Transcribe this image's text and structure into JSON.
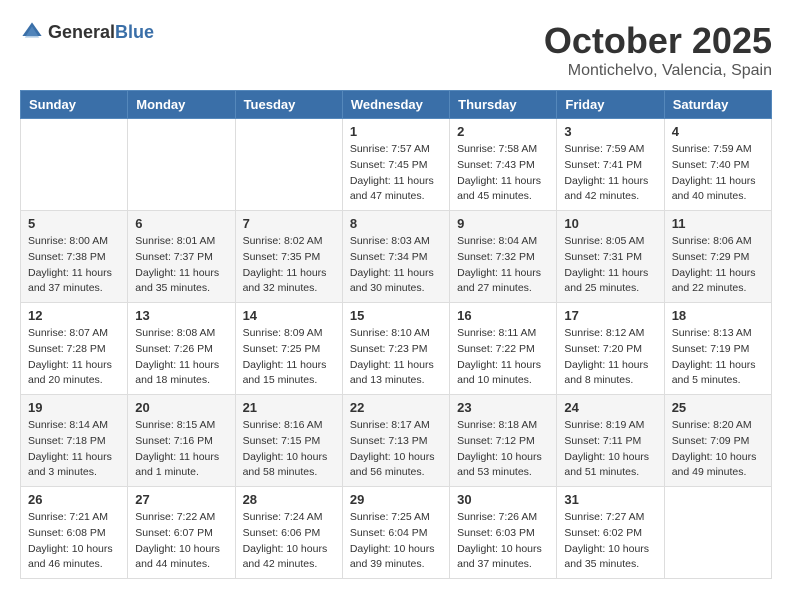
{
  "header": {
    "logo_general": "General",
    "logo_blue": "Blue",
    "month": "October 2025",
    "location": "Montichelvo, Valencia, Spain"
  },
  "days_of_week": [
    "Sunday",
    "Monday",
    "Tuesday",
    "Wednesday",
    "Thursday",
    "Friday",
    "Saturday"
  ],
  "weeks": [
    [
      {
        "day": "",
        "info": ""
      },
      {
        "day": "",
        "info": ""
      },
      {
        "day": "",
        "info": ""
      },
      {
        "day": "1",
        "info": "Sunrise: 7:57 AM\nSunset: 7:45 PM\nDaylight: 11 hours and 47 minutes."
      },
      {
        "day": "2",
        "info": "Sunrise: 7:58 AM\nSunset: 7:43 PM\nDaylight: 11 hours and 45 minutes."
      },
      {
        "day": "3",
        "info": "Sunrise: 7:59 AM\nSunset: 7:41 PM\nDaylight: 11 hours and 42 minutes."
      },
      {
        "day": "4",
        "info": "Sunrise: 7:59 AM\nSunset: 7:40 PM\nDaylight: 11 hours and 40 minutes."
      }
    ],
    [
      {
        "day": "5",
        "info": "Sunrise: 8:00 AM\nSunset: 7:38 PM\nDaylight: 11 hours and 37 minutes."
      },
      {
        "day": "6",
        "info": "Sunrise: 8:01 AM\nSunset: 7:37 PM\nDaylight: 11 hours and 35 minutes."
      },
      {
        "day": "7",
        "info": "Sunrise: 8:02 AM\nSunset: 7:35 PM\nDaylight: 11 hours and 32 minutes."
      },
      {
        "day": "8",
        "info": "Sunrise: 8:03 AM\nSunset: 7:34 PM\nDaylight: 11 hours and 30 minutes."
      },
      {
        "day": "9",
        "info": "Sunrise: 8:04 AM\nSunset: 7:32 PM\nDaylight: 11 hours and 27 minutes."
      },
      {
        "day": "10",
        "info": "Sunrise: 8:05 AM\nSunset: 7:31 PM\nDaylight: 11 hours and 25 minutes."
      },
      {
        "day": "11",
        "info": "Sunrise: 8:06 AM\nSunset: 7:29 PM\nDaylight: 11 hours and 22 minutes."
      }
    ],
    [
      {
        "day": "12",
        "info": "Sunrise: 8:07 AM\nSunset: 7:28 PM\nDaylight: 11 hours and 20 minutes."
      },
      {
        "day": "13",
        "info": "Sunrise: 8:08 AM\nSunset: 7:26 PM\nDaylight: 11 hours and 18 minutes."
      },
      {
        "day": "14",
        "info": "Sunrise: 8:09 AM\nSunset: 7:25 PM\nDaylight: 11 hours and 15 minutes."
      },
      {
        "day": "15",
        "info": "Sunrise: 8:10 AM\nSunset: 7:23 PM\nDaylight: 11 hours and 13 minutes."
      },
      {
        "day": "16",
        "info": "Sunrise: 8:11 AM\nSunset: 7:22 PM\nDaylight: 11 hours and 10 minutes."
      },
      {
        "day": "17",
        "info": "Sunrise: 8:12 AM\nSunset: 7:20 PM\nDaylight: 11 hours and 8 minutes."
      },
      {
        "day": "18",
        "info": "Sunrise: 8:13 AM\nSunset: 7:19 PM\nDaylight: 11 hours and 5 minutes."
      }
    ],
    [
      {
        "day": "19",
        "info": "Sunrise: 8:14 AM\nSunset: 7:18 PM\nDaylight: 11 hours and 3 minutes."
      },
      {
        "day": "20",
        "info": "Sunrise: 8:15 AM\nSunset: 7:16 PM\nDaylight: 11 hours and 1 minute."
      },
      {
        "day": "21",
        "info": "Sunrise: 8:16 AM\nSunset: 7:15 PM\nDaylight: 10 hours and 58 minutes."
      },
      {
        "day": "22",
        "info": "Sunrise: 8:17 AM\nSunset: 7:13 PM\nDaylight: 10 hours and 56 minutes."
      },
      {
        "day": "23",
        "info": "Sunrise: 8:18 AM\nSunset: 7:12 PM\nDaylight: 10 hours and 53 minutes."
      },
      {
        "day": "24",
        "info": "Sunrise: 8:19 AM\nSunset: 7:11 PM\nDaylight: 10 hours and 51 minutes."
      },
      {
        "day": "25",
        "info": "Sunrise: 8:20 AM\nSunset: 7:09 PM\nDaylight: 10 hours and 49 minutes."
      }
    ],
    [
      {
        "day": "26",
        "info": "Sunrise: 7:21 AM\nSunset: 6:08 PM\nDaylight: 10 hours and 46 minutes."
      },
      {
        "day": "27",
        "info": "Sunrise: 7:22 AM\nSunset: 6:07 PM\nDaylight: 10 hours and 44 minutes."
      },
      {
        "day": "28",
        "info": "Sunrise: 7:24 AM\nSunset: 6:06 PM\nDaylight: 10 hours and 42 minutes."
      },
      {
        "day": "29",
        "info": "Sunrise: 7:25 AM\nSunset: 6:04 PM\nDaylight: 10 hours and 39 minutes."
      },
      {
        "day": "30",
        "info": "Sunrise: 7:26 AM\nSunset: 6:03 PM\nDaylight: 10 hours and 37 minutes."
      },
      {
        "day": "31",
        "info": "Sunrise: 7:27 AM\nSunset: 6:02 PM\nDaylight: 10 hours and 35 minutes."
      },
      {
        "day": "",
        "info": ""
      }
    ]
  ]
}
